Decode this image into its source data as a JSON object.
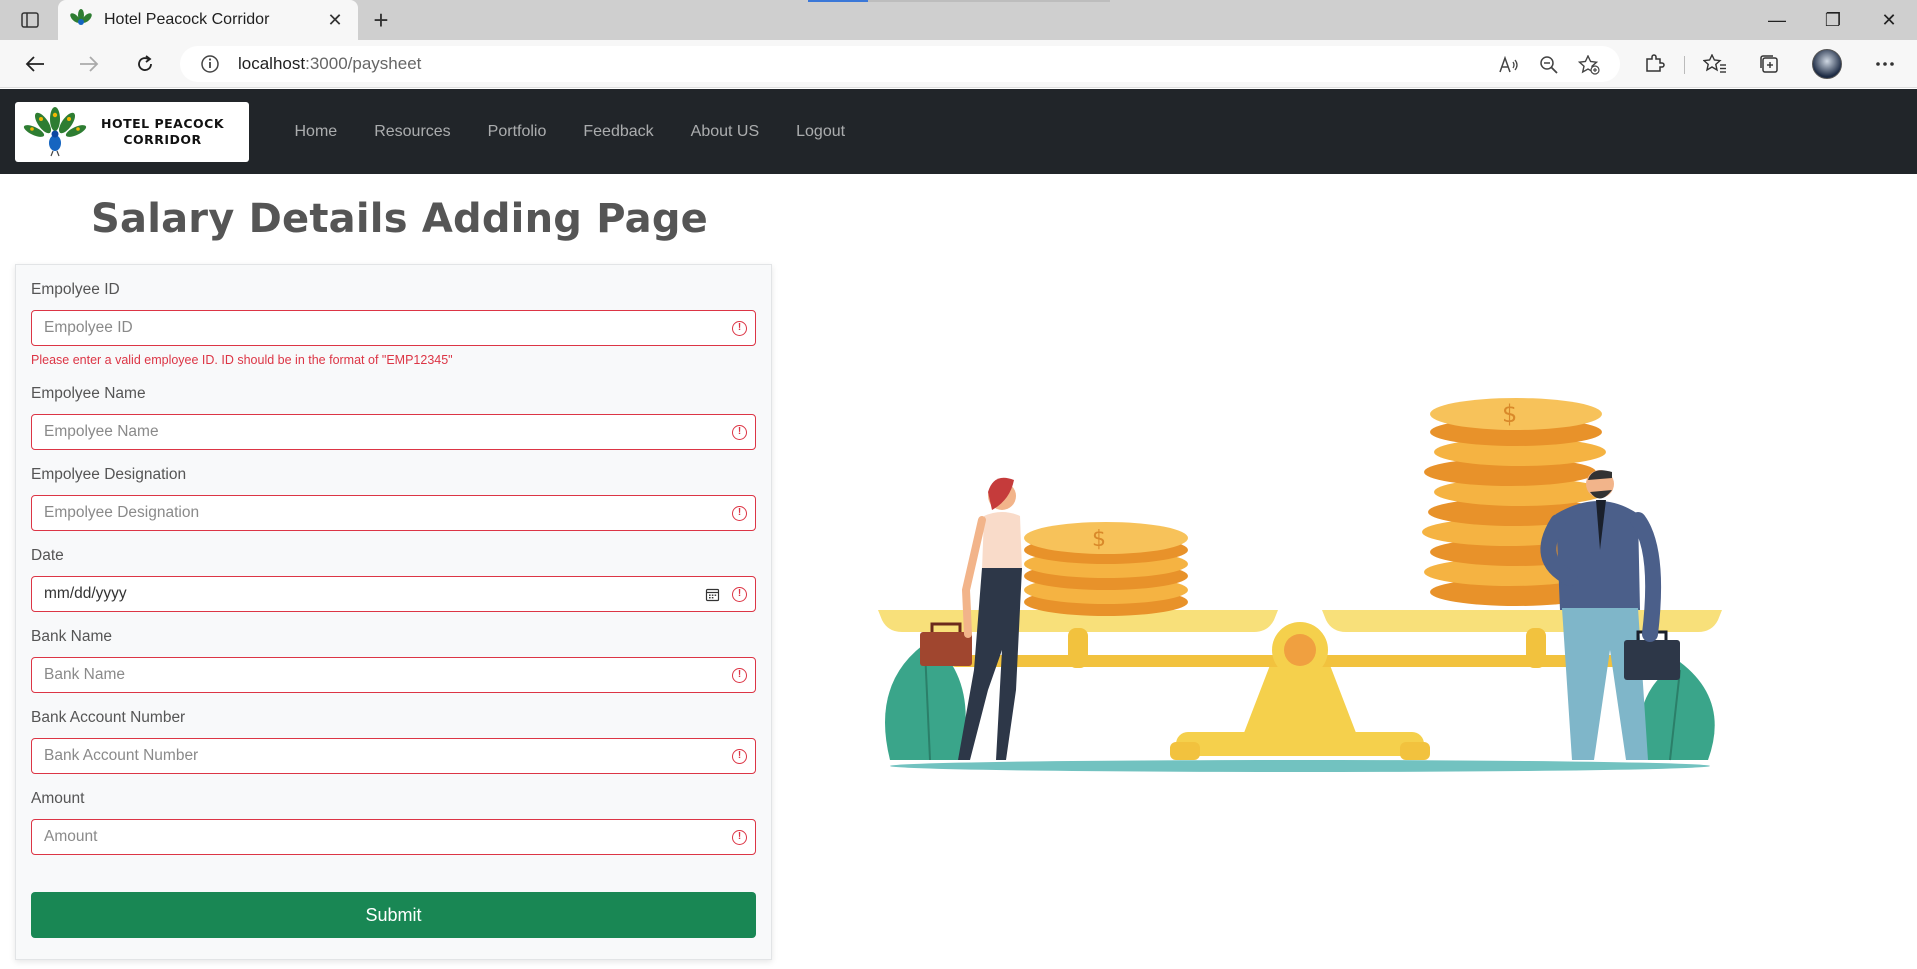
{
  "browser": {
    "tab_title": "Hotel Peacock Corridor",
    "tab_close": "✕",
    "new_tab": "+",
    "url_host": "localhost",
    "url_path": ":3000/paysheet",
    "window_controls": [
      "—",
      "❐",
      "✕"
    ]
  },
  "site": {
    "logo_line1": "HOTEL PEACOCK",
    "logo_line2": "CORRIDOR",
    "nav": [
      "Home",
      "Resources",
      "Portfolio",
      "Feedback",
      "About US",
      "Logout"
    ]
  },
  "page": {
    "title": "Salary Details Adding Page"
  },
  "form": {
    "fields": [
      {
        "label": "Empolyee ID",
        "placeholder": "Empolyee ID",
        "error": "Please enter a valid employee ID. ID should be in the format of \"EMP12345\""
      },
      {
        "label": "Empolyee Name",
        "placeholder": "Empolyee Name"
      },
      {
        "label": "Empolyee Designation",
        "placeholder": "Empolyee Designation"
      },
      {
        "label": "Date",
        "placeholder": "mm/dd/yyyy"
      },
      {
        "label": "Bank Name",
        "placeholder": "Bank Name"
      },
      {
        "label": "Bank Account Number",
        "placeholder": "Bank Account Number"
      },
      {
        "label": "Amount",
        "placeholder": "Amount"
      }
    ],
    "error_glyph": "!",
    "submit_label": "Submit"
  },
  "colors": {
    "header_bg": "#212529",
    "error": "#dc3545",
    "submit": "#198754",
    "title": "#555555"
  }
}
